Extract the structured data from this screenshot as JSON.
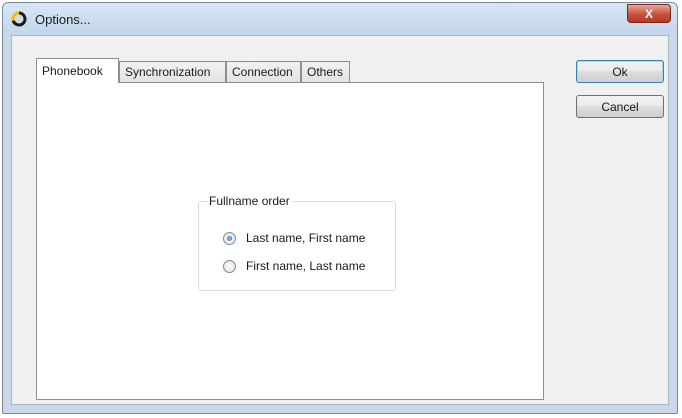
{
  "window": {
    "title": "Options...",
    "close_label": "X"
  },
  "tabs": [
    {
      "label": "Phonebook",
      "active": true
    },
    {
      "label": "Synchronization",
      "active": false
    },
    {
      "label": "Connection",
      "active": false
    },
    {
      "label": "Others",
      "active": false
    }
  ],
  "fullname_group": {
    "legend": "Fullname order",
    "options": [
      {
        "label": "Last name, First name",
        "selected": true
      },
      {
        "label": "First name, Last name",
        "selected": false
      }
    ]
  },
  "buttons": {
    "ok_label": "Ok",
    "cancel_label": "Cancel"
  },
  "colors": {
    "accent": "#3c7fb1",
    "close": "#c6523d"
  },
  "icons": {
    "app": "sync-circle-icon",
    "close": "close-icon"
  }
}
